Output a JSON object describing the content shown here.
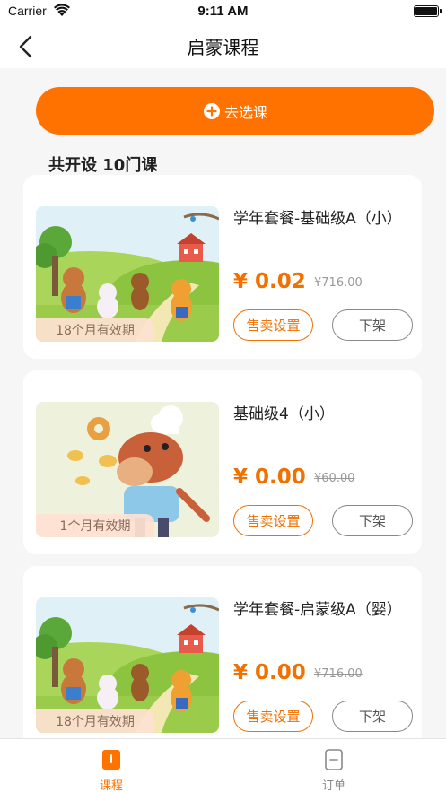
{
  "status": {
    "carrier": "Carrier",
    "time": "9:11 AM"
  },
  "nav": {
    "title": "启蒙课程"
  },
  "actions": {
    "select_course_label": "去选课"
  },
  "summary": {
    "count_text": "共开设 10门课"
  },
  "courses": [
    {
      "title": "学年套餐-基础级A（小）",
      "price": "¥ 0.02",
      "original_price": "¥716.00",
      "validity": "18个月有效期",
      "sale_settings_label": "售卖设置",
      "delist_label": "下架",
      "image": "farm-animals-illustration"
    },
    {
      "title": "基础级4（小）",
      "price": "¥ 0.00",
      "original_price": "¥60.00",
      "validity": "1个月有效期",
      "sale_settings_label": "售卖设置",
      "delist_label": "下架",
      "image": "horse-chef-illustration"
    },
    {
      "title": "学年套餐-启蒙级A（婴）",
      "price": "¥ 0.00",
      "original_price": "¥716.00",
      "validity": "18个月有效期",
      "sale_settings_label": "售卖设置",
      "delist_label": "下架",
      "image": "farm-animals-illustration"
    }
  ],
  "tabs": [
    {
      "label": "课程",
      "icon": "book-icon",
      "active": true
    },
    {
      "label": "订单",
      "icon": "order-icon",
      "active": false
    }
  ],
  "colors": {
    "accent": "#ff7200",
    "price": "#f07000",
    "inactive_tab": "#888888"
  }
}
